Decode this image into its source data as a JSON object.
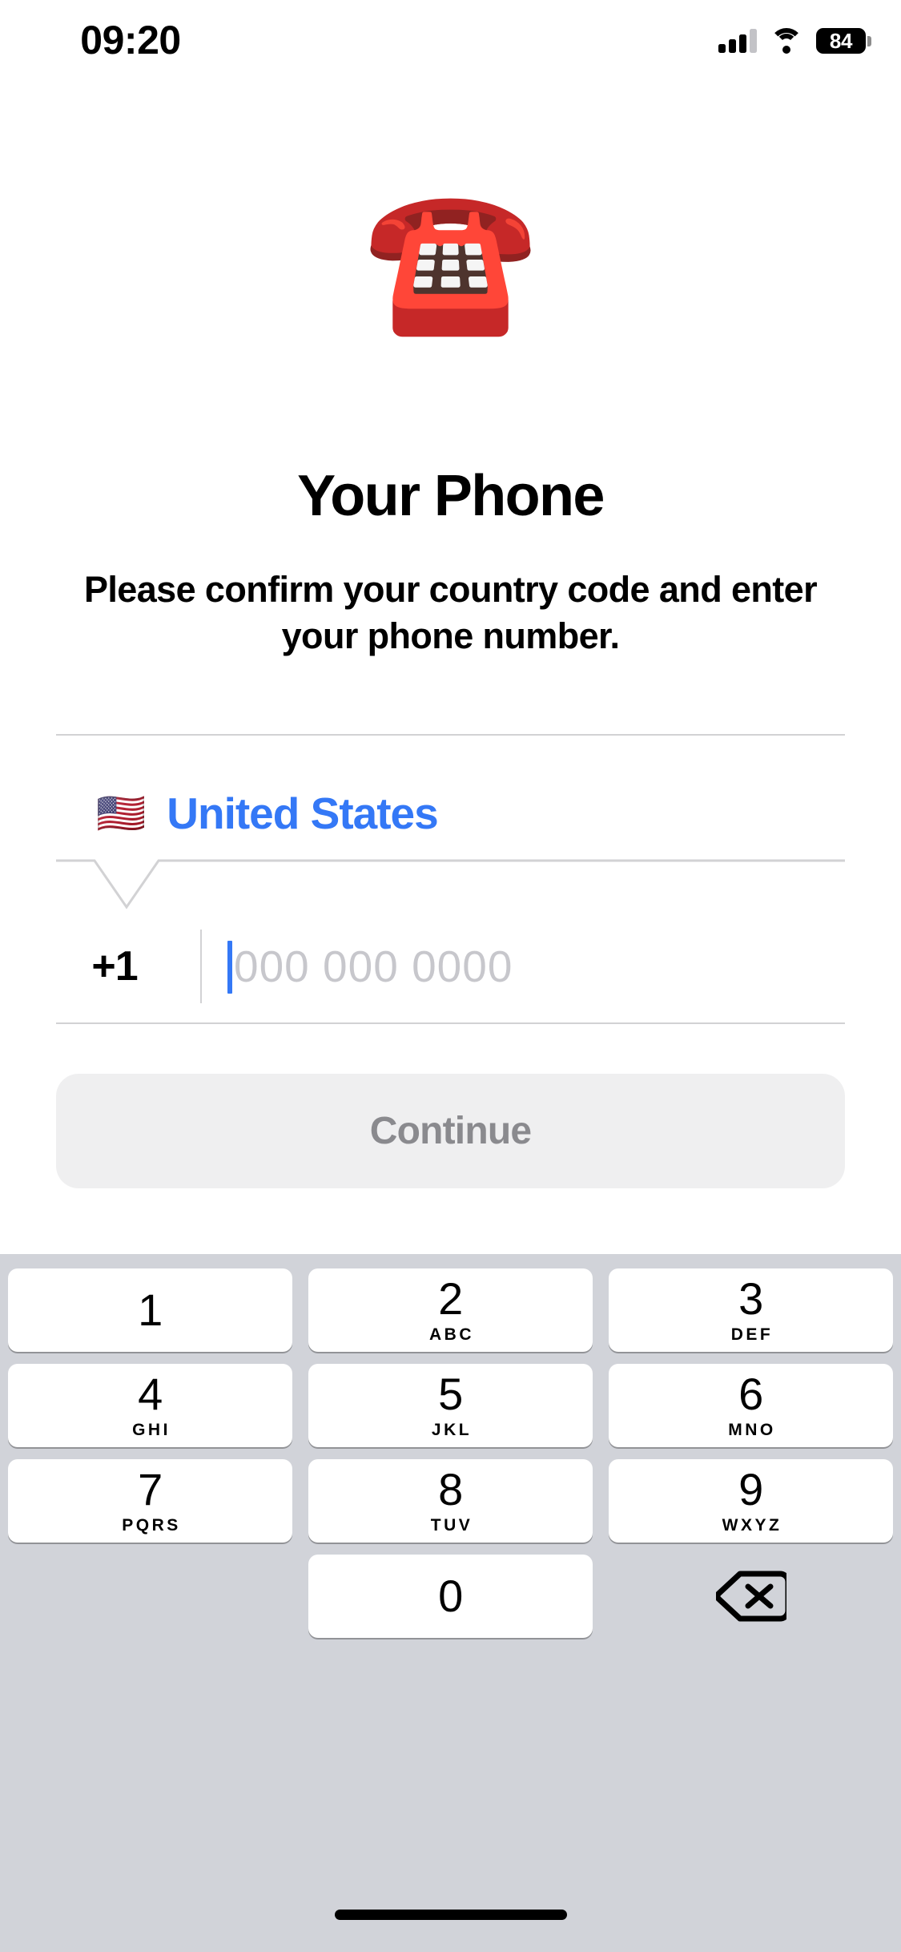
{
  "status_bar": {
    "time": "09:20",
    "cellular_icon": "cellular-bars-icon",
    "cellular_bars_filled": 3,
    "cellular_bars_total": 4,
    "wifi_icon": "wifi-icon",
    "battery_icon": "battery-icon",
    "battery_level": "84"
  },
  "hero": {
    "emoji": "☎️",
    "emoji_name": "telephone-emoji"
  },
  "content": {
    "title": "Your Phone",
    "subtitle": "Please confirm your country code and enter your phone number."
  },
  "form": {
    "country": {
      "flag": "🇺🇸",
      "name": "United States"
    },
    "phone": {
      "country_code": "+1",
      "value": "",
      "placeholder": "000 000 0000"
    }
  },
  "actions": {
    "continue_label": "Continue",
    "continue_enabled": false
  },
  "keypad": {
    "keys": [
      {
        "digit": "1",
        "letters": ""
      },
      {
        "digit": "2",
        "letters": "ABC"
      },
      {
        "digit": "3",
        "letters": "DEF"
      },
      {
        "digit": "4",
        "letters": "GHI"
      },
      {
        "digit": "5",
        "letters": "JKL"
      },
      {
        "digit": "6",
        "letters": "MNO"
      },
      {
        "digit": "7",
        "letters": "PQRS"
      },
      {
        "digit": "8",
        "letters": "TUV"
      },
      {
        "digit": "9",
        "letters": "WXYZ"
      },
      {
        "digit": "0",
        "letters": ""
      }
    ],
    "backspace_icon": "backspace-delete-icon"
  },
  "colors": {
    "accent_blue": "#3478f6",
    "placeholder_gray": "#c7c7cc",
    "divider_gray": "#d2d2d4",
    "button_disabled_bg": "#efeff0",
    "button_disabled_text": "#8a8a8e",
    "keypad_bg": "#d1d3d9",
    "key_bg": "#ffffff",
    "text_black": "#000000"
  }
}
